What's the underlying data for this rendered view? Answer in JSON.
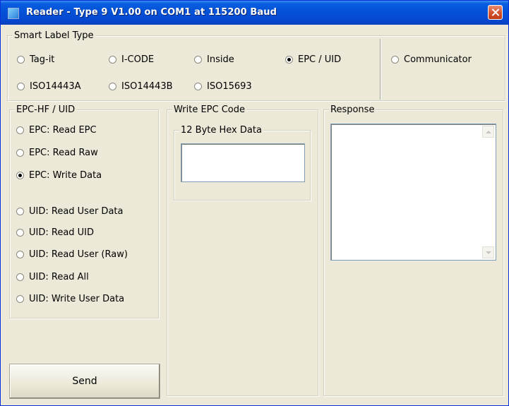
{
  "window": {
    "title": "Reader - Type 9 V1.00 on COM1 at 115200 Baud"
  },
  "smart_label": {
    "title": "Smart Label Type",
    "options": [
      {
        "label": "Tag-it",
        "selected": false
      },
      {
        "label": "I-CODE",
        "selected": false
      },
      {
        "label": "Inside",
        "selected": false
      },
      {
        "label": "EPC / UID",
        "selected": true
      },
      {
        "label": "Communicator",
        "selected": false
      },
      {
        "label": "ISO14443A",
        "selected": false
      },
      {
        "label": "ISO14443B",
        "selected": false
      },
      {
        "label": "ISO15693",
        "selected": false
      }
    ]
  },
  "epc_uid": {
    "title": "EPC-HF / UID",
    "options": [
      {
        "label": "EPC: Read EPC",
        "selected": false
      },
      {
        "label": "EPC: Read Raw",
        "selected": false
      },
      {
        "label": "EPC: Write Data",
        "selected": true
      },
      {
        "label": "UID: Read User Data",
        "selected": false
      },
      {
        "label": "UID: Read UID",
        "selected": false
      },
      {
        "label": "UID: Read User (Raw)",
        "selected": false
      },
      {
        "label": "UID: Read All",
        "selected": false
      },
      {
        "label": "UID: Write User Data",
        "selected": false
      }
    ]
  },
  "write_epc": {
    "title": "Write EPC Code",
    "hex_title": "12 Byte Hex Data",
    "value": ""
  },
  "response": {
    "title": "Response",
    "value": ""
  },
  "send_label": "Send",
  "colors": {
    "titlebar": "#0453d8",
    "background": "#ece9d8",
    "close": "#d2502b"
  }
}
